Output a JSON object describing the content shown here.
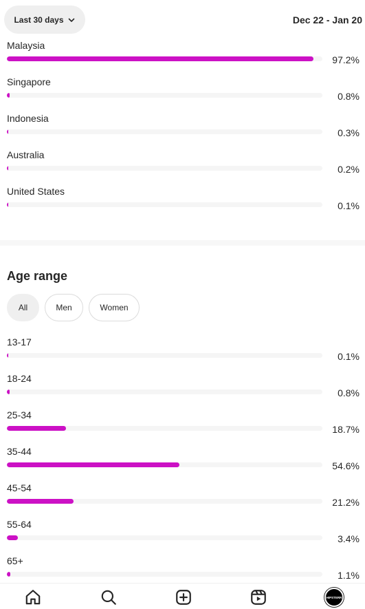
{
  "header": {
    "range_label": "Last 30 days",
    "date_range": "Dec 22 - Jan 20"
  },
  "locations": [
    {
      "label": "Malaysia",
      "value": 97.2,
      "pct": "97.2%"
    },
    {
      "label": "Singapore",
      "value": 0.8,
      "pct": "0.8%"
    },
    {
      "label": "Indonesia",
      "value": 0.3,
      "pct": "0.3%"
    },
    {
      "label": "Australia",
      "value": 0.2,
      "pct": "0.2%"
    },
    {
      "label": "United States",
      "value": 0.1,
      "pct": "0.1%"
    }
  ],
  "age_range": {
    "title": "Age range",
    "filters": [
      "All",
      "Men",
      "Women"
    ],
    "selected_filter": "All",
    "rows": [
      {
        "label": "13-17",
        "value": 0.1,
        "pct": "0.1%"
      },
      {
        "label": "18-24",
        "value": 0.8,
        "pct": "0.8%"
      },
      {
        "label": "25-34",
        "value": 18.7,
        "pct": "18.7%"
      },
      {
        "label": "35-44",
        "value": 54.6,
        "pct": "54.6%"
      },
      {
        "label": "45-54",
        "value": 21.2,
        "pct": "21.2%"
      },
      {
        "label": "55-64",
        "value": 3.4,
        "pct": "3.4%"
      },
      {
        "label": "65+",
        "value": 1.1,
        "pct": "1.1%"
      }
    ]
  },
  "nav": {
    "items": [
      "home-icon",
      "search-icon",
      "create-icon",
      "reels-icon",
      "profile-avatar"
    ],
    "avatar_text": "HIPSTERR"
  },
  "colors": {
    "accent": "#cc11c5",
    "track": "#f5f5f5",
    "chip_active": "#efefef"
  }
}
